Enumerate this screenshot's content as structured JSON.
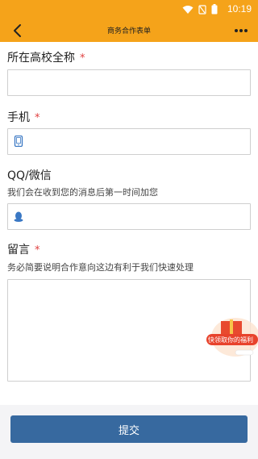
{
  "status_bar": {
    "time": "10:19",
    "icons": [
      "wifi-icon",
      "sim-icon",
      "battery-icon"
    ]
  },
  "navbar": {
    "title": "商务合作表单",
    "back_icon": "back-arrow-icon",
    "more_icon": "more-dots-icon"
  },
  "form": {
    "fields": [
      {
        "label": "所在高校全称",
        "required_mark": "*",
        "value": "",
        "placeholder": ""
      },
      {
        "label": "手机",
        "required_mark": "*",
        "icon": "phone-icon",
        "value": "",
        "placeholder": ""
      },
      {
        "label": "QQ/微信",
        "hint": "我们会在收到您的消息后第一时间加您",
        "icon": "qq-icon",
        "value": "",
        "placeholder": ""
      },
      {
        "label": "留言",
        "required_mark": "*",
        "hint": "务必简要说明合作意向这边有利于我们快速处理",
        "value": "",
        "placeholder": ""
      }
    ]
  },
  "floating_promo": {
    "text": "快领取你的福利"
  },
  "submit_label": "提交",
  "colors": {
    "header": "#f5a31a",
    "required": "#e04040",
    "submit": "#37699f",
    "footer_bg": "#f4f4f6"
  }
}
